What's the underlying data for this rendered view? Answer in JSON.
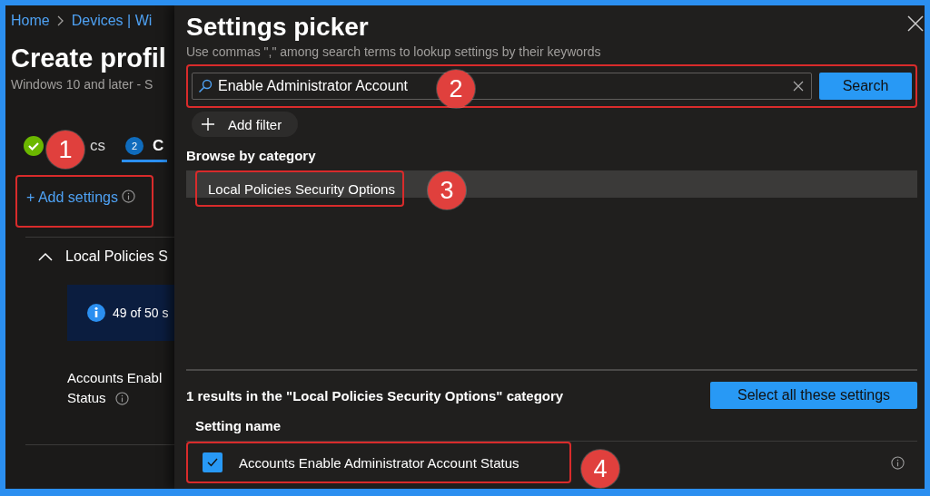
{
  "breadcrumb": [
    {
      "label": "Home"
    },
    {
      "label": "Devices | Wi"
    }
  ],
  "page": {
    "title": "Create profil",
    "subtitle": "Windows 10 and later - S"
  },
  "steps": [
    {
      "label": "cs",
      "done": true,
      "selected": false
    },
    {
      "number": "2",
      "label": "C",
      "done": false,
      "selected": true
    }
  ],
  "add_settings": {
    "label": "+ Add settings"
  },
  "section": {
    "title": "Local Policies S",
    "expanded": true,
    "info": "49 of 50 s",
    "setting_lines": [
      "Accounts Enabl",
      "Status"
    ]
  },
  "picker": {
    "title": "Settings picker",
    "hint": "Use commas \",\" among search terms to lookup settings by their keywords",
    "search_value": "Enable Administrator Account",
    "search_button": "Search",
    "add_filter": "Add filter",
    "browse_heading": "Browse by category",
    "categories": [
      {
        "label": "Local Policies Security Options",
        "selected": true
      }
    ],
    "results_text": "1 results in the \"Local Policies Security Options\" category",
    "select_all": "Select all these settings",
    "column": "Setting name",
    "results": [
      {
        "label": "Accounts Enable Administrator Account Status",
        "checked": true
      }
    ]
  },
  "annotations": [
    {
      "label": "1"
    },
    {
      "label": "2"
    },
    {
      "label": "3"
    },
    {
      "label": "4"
    }
  ]
}
